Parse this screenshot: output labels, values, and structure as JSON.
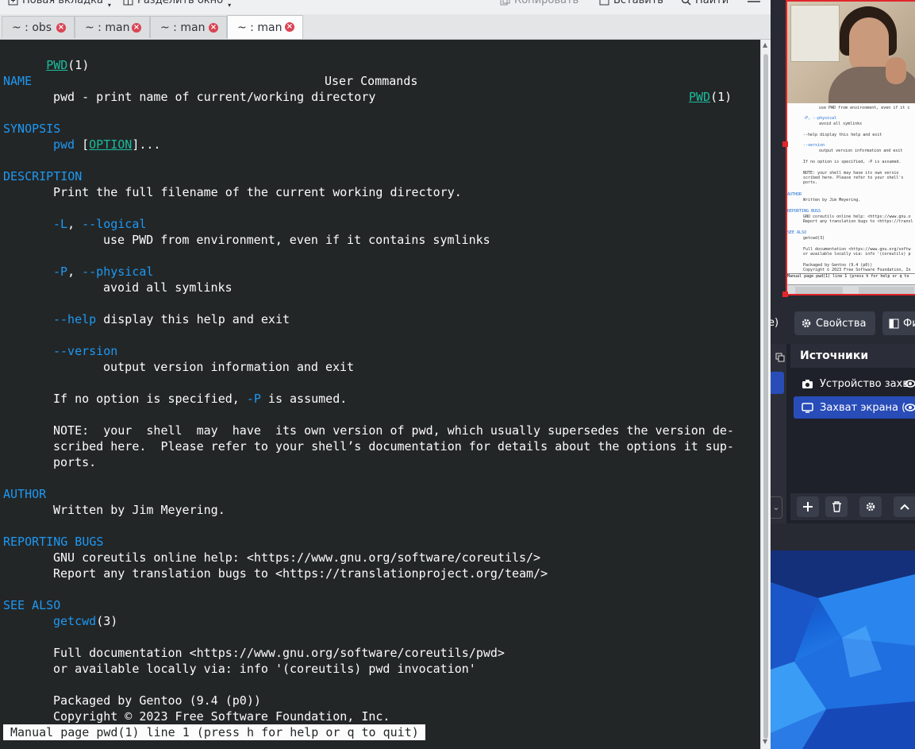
{
  "toolbar": {
    "new_tab": "Новая вкладка",
    "split": "Разделить окно",
    "copy": "Копировать",
    "paste": "Вставить",
    "find": "Найти"
  },
  "tabs": [
    {
      "label": "~ : obs",
      "active": false
    },
    {
      "label": "~ : man",
      "active": false
    },
    {
      "label": "~ : man",
      "active": false
    },
    {
      "label": "~ : man",
      "active": true
    }
  ],
  "man": {
    "header_left_name": "PWD",
    "header_left_sect": "(1)",
    "header_center": "User Commands",
    "header_right_name": "PWD",
    "header_right_sect": "(1)",
    "name_heading": "NAME",
    "name_text": "pwd - print name of current/working directory",
    "synopsis_heading": "SYNOPSIS",
    "synopsis_cmd": "pwd",
    "synopsis_open": " [",
    "synopsis_option": "OPTION",
    "synopsis_close": "]...",
    "description_heading": "DESCRIPTION",
    "description_text": "Print the full filename of the current working directory.",
    "opt_L": "-L",
    "opt_L_sep": ", ",
    "opt_L_long": "--logical",
    "opt_L_desc": "use PWD from environment, even if it contains symlinks",
    "opt_P": "-P",
    "opt_P_sep": ", ",
    "opt_P_long": "--physical",
    "opt_P_desc": "avoid all symlinks",
    "opt_help": "--help",
    "opt_help_desc": " display this help and exit",
    "opt_version": "--version",
    "opt_version_desc": "output version information and exit",
    "noopt_pre": "If no option is specified, ",
    "noopt_flag": "-P",
    "noopt_post": " is assumed.",
    "note_1": "NOTE:  your  shell  may  have  its own version of pwd, which usually supersedes the version de‐",
    "note_2": "scribed here.  Please refer to your shell’s documentation for details about the options it sup‐",
    "note_3": "ports.",
    "author_heading": "AUTHOR",
    "author_text": "Written by Jim Meyering.",
    "bugs_heading": "REPORTING BUGS",
    "bugs_1": "GNU coreutils online help: <https://www.gnu.org/software/coreutils/>",
    "bugs_2": "Report any translation bugs to <https://translationproject.org/team/>",
    "seealso_heading": "SEE ALSO",
    "seealso_ref": "getcwd",
    "seealso_ref_sect": "(3)",
    "seealso_doc_1": "Full documentation <https://www.gnu.org/software/coreutils/pwd>",
    "seealso_doc_2": "or available locally via: info '(coreutils) pwd invocation'",
    "packaged": "Packaged by Gentoo (9.4 (p0))",
    "copyright": "Copyright © 2023 Free Software Foundation, Inc.",
    "status": "Manual page pwd(1) line 1 (press h for help or q to quit)"
  },
  "obs": {
    "properties": "Свойства",
    "filters_partial": "Фи",
    "left_partial": "e)",
    "sources_title": "Источники",
    "sources": [
      {
        "label": "Устройство захв",
        "icon": "camera-icon",
        "selected": false
      },
      {
        "label": "Захват экрана (",
        "icon": "monitor-icon",
        "selected": true
      }
    ]
  },
  "colors": {
    "terminal_bg": "#232627",
    "heading_blue": "#1d99f3",
    "link_teal": "#1abc9c",
    "close_red": "#da4453",
    "obs_selected": "#284cb8"
  }
}
